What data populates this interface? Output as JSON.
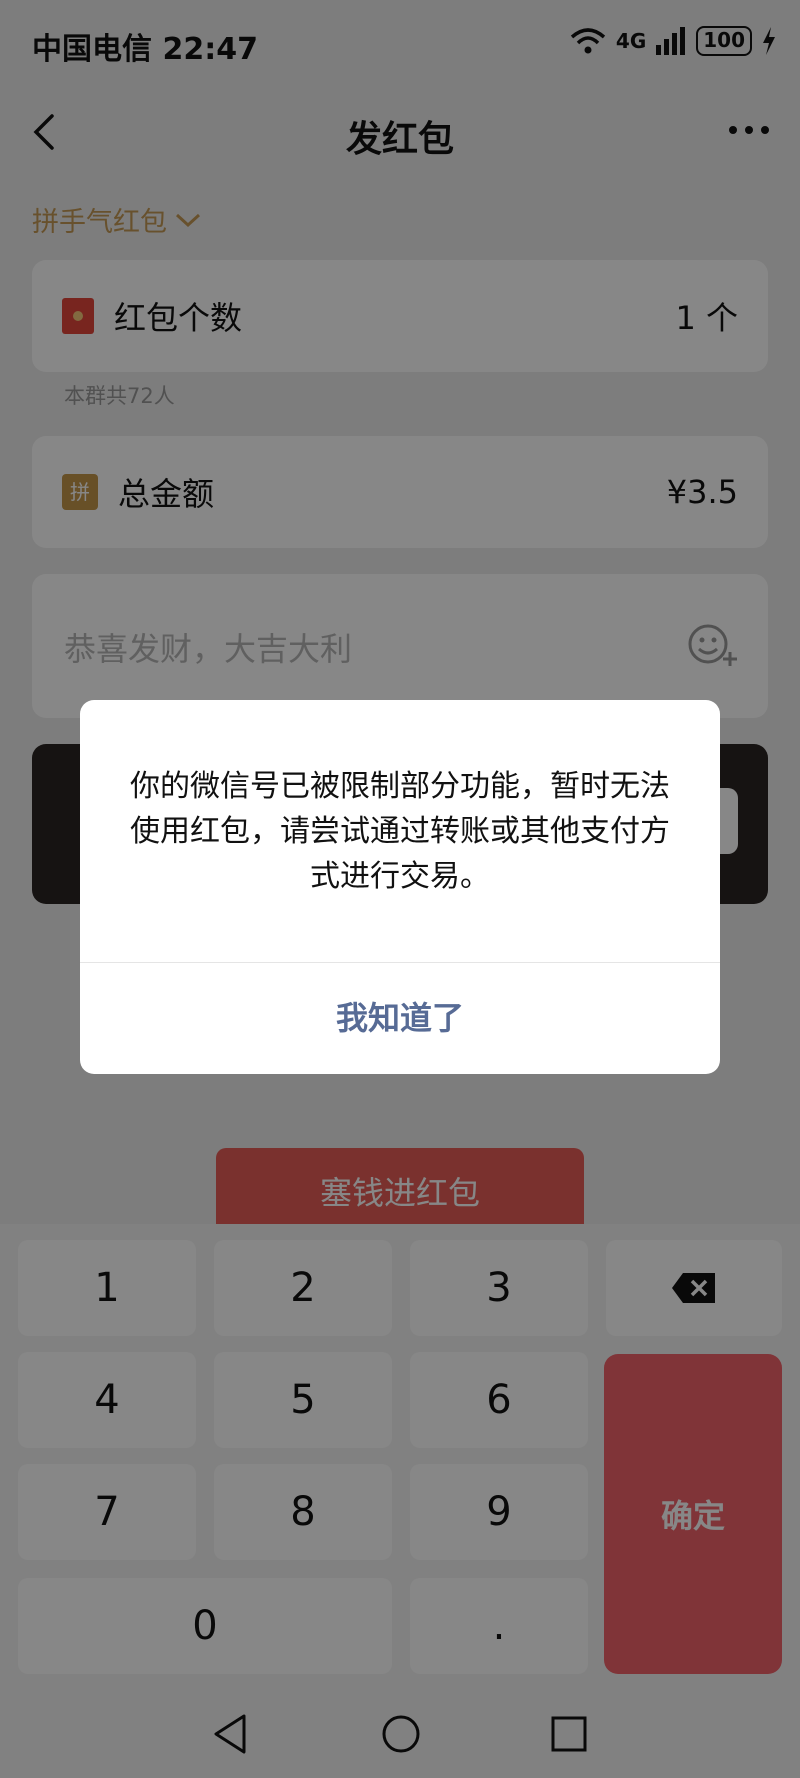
{
  "status_bar": {
    "carrier_time": "中国电信 22:47",
    "network": "4G",
    "battery": "100"
  },
  "nav": {
    "title": "发红包"
  },
  "form": {
    "type_selector": "拼手气红包",
    "count_label": "红包个数",
    "count_value": "1 个",
    "group_note": "本群共72人",
    "pin_icon_text": "拼",
    "total_label": "总金额",
    "total_value": "¥3.5",
    "greeting_placeholder": "恭喜发财，大吉大利",
    "send_button": "塞钱进红包"
  },
  "keypad": {
    "keys": [
      "1",
      "2",
      "3",
      "4",
      "5",
      "6",
      "7",
      "8",
      "9",
      "0",
      "."
    ],
    "confirm": "确定"
  },
  "dialog": {
    "message": "你的微信号已被限制部分功能，暂时无法使用红包，请尝试通过转账或其他支付方式进行交易。",
    "button": "我知道了"
  },
  "colors": {
    "red": "#e75e58",
    "gold": "#c49a56",
    "dialog_button": "#576b95",
    "confirm_key": "#f1636b"
  }
}
